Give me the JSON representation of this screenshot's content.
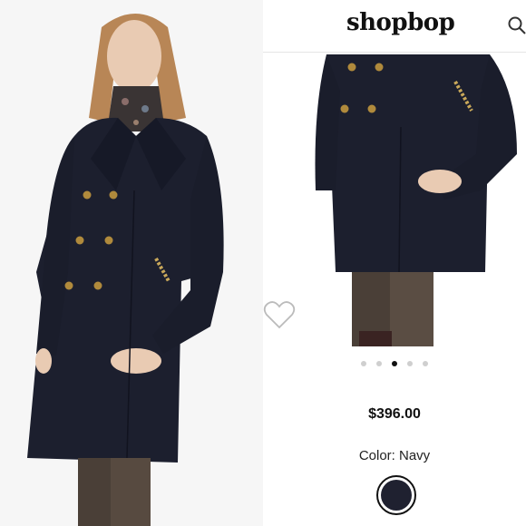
{
  "brand": {
    "logo_text": "shopbop"
  },
  "header": {
    "search_icon": "search-icon"
  },
  "product": {
    "price": "$396.00",
    "color_label": "Color: Navy",
    "swatch_color": "#1f2130",
    "gallery": {
      "total_images": 5,
      "active_index": 2
    }
  },
  "colors": {
    "coat": "#1c1f2e",
    "buttons": "#b08a3c",
    "pants": "#4a3f37",
    "skin": "#e9cbb3",
    "hair": "#b88656"
  }
}
